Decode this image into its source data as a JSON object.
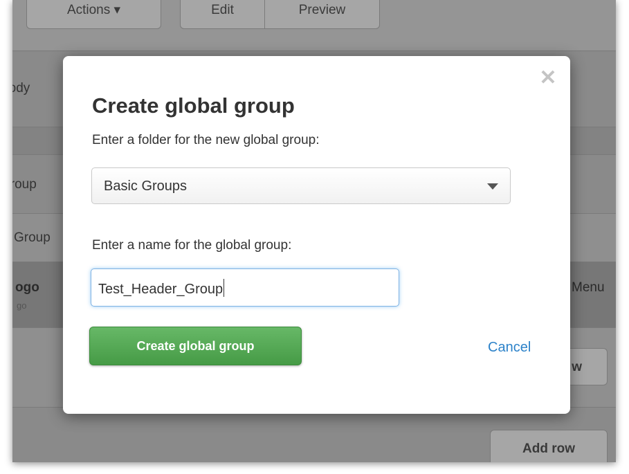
{
  "background": {
    "toolbar_buttons": [
      "Actions ▾",
      "Edit",
      "Preview"
    ],
    "rows": [
      {
        "left": "Body"
      },
      {
        "left": "Group"
      },
      {
        "left": "Group"
      },
      {
        "left": "ogo",
        "sub": "go",
        "right": "Menu"
      }
    ],
    "add_row_partial": "w",
    "add_row": "Add row"
  },
  "modal": {
    "title": "Create global group",
    "folder_label": "Enter a folder for the new global group:",
    "folder_value": "Basic Groups",
    "name_label": "Enter a name for the global group:",
    "name_value": "Test_Header_Group",
    "create_button": "Create global group",
    "cancel_link": "Cancel",
    "close_symbol": "✕"
  },
  "colors": {
    "primary_button": "#469b46",
    "link": "#2c82c9",
    "focus_ring": "#52a8ec"
  }
}
